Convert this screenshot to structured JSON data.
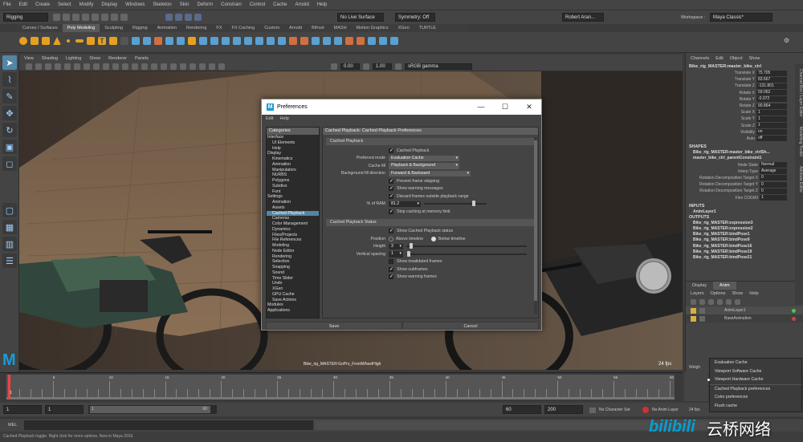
{
  "menubar": [
    "File",
    "Edit",
    "Create",
    "Select",
    "Modify",
    "Display",
    "Windows",
    "Skeleton",
    "Skin",
    "Deform",
    "Constrain",
    "Control",
    "Cache",
    "Arnold",
    "Help"
  ],
  "status": {
    "menuset": "Rigging",
    "live_surface": "No Live Surface",
    "symmetry": "Symmetry: Off",
    "user": "Robert Aran...",
    "workspace_label": "Workspace :",
    "workspace": "Maya Classic*"
  },
  "shelf_tabs": [
    "Curves / Surfaces",
    "Poly Modeling",
    "Sculpting",
    "Rigging",
    "Animation",
    "Rendering",
    "FX",
    "FX Caching",
    "Custom",
    "Arnold",
    "Bifrost",
    "MASH",
    "Motion Graphics",
    "XGen",
    "TURTLE"
  ],
  "shelf_active_tab": "Poly Modeling",
  "panel_menu": [
    "View",
    "Shading",
    "Lighting",
    "Show",
    "Renderer",
    "Panels"
  ],
  "viewport": {
    "exposure": "0.00",
    "gamma": "1.00",
    "colorspace": "sRGB gamma",
    "camera_label": "Bike_rig_MASTER:GoPro_FrontWheelHigh",
    "fps": "24 fps"
  },
  "channel_box": {
    "menu": [
      "Channels",
      "Edit",
      "Object",
      "Show"
    ],
    "object": "Bike_rig_MASTER:master_bike_ctrl",
    "channels": [
      {
        "name": "Translate X",
        "value": "75.705"
      },
      {
        "name": "Translate Y",
        "value": "83.667"
      },
      {
        "name": "Translate Z",
        "value": "-131.801"
      },
      {
        "name": "Rotate X",
        "value": "59.062"
      },
      {
        "name": "Rotate Y",
        "value": "-0.072"
      },
      {
        "name": "Rotate Z",
        "value": "90.864"
      },
      {
        "name": "Scale X",
        "value": "1"
      },
      {
        "name": "Scale Y",
        "value": "1"
      },
      {
        "name": "Scale Z",
        "value": "1"
      },
      {
        "name": "Visibility",
        "value": "on"
      },
      {
        "name": "Auto",
        "value": "off"
      }
    ],
    "shapes_header": "SHAPES",
    "shapes": [
      "Bike_rig_MASTER:master_bike_ctrlSh...",
      "master_bike_ctrl_parentConstraint1"
    ],
    "constraint_attrs": [
      {
        "name": "Node State",
        "value": "Normal"
      },
      {
        "name": "Interp Type",
        "value": "Average"
      },
      {
        "name": "Rotation Decomposition Target X",
        "value": "0"
      },
      {
        "name": "Rotation Decomposition Target Y",
        "value": "0"
      },
      {
        "name": "Rotation Decomposition Target Z",
        "value": "0"
      },
      {
        "name": "Flex COGWt",
        "value": "1"
      }
    ],
    "inputs_header": "INPUTS",
    "inputs": [
      "AnimLayer1"
    ],
    "outputs_header": "OUTPUTS",
    "outputs": [
      "Bike_rig_MASTER:expression3",
      "Bike_rig_MASTER:expression2",
      "Bike_rig_MASTER:bindPose1",
      "Bike_rig_MASTER:bindPose9",
      "Bike_rig_MASTER:bindPose16",
      "Bike_rig_MASTER:bindPose19",
      "Bike_rig_MASTER:bindPose21"
    ]
  },
  "side_tabs": [
    "Channel Box / Layer Editor",
    "Modelling Toolkit",
    "Attribute Editor"
  ],
  "layer_editor": {
    "tabs": [
      "Display",
      "Anim"
    ],
    "menu": [
      "Layers",
      "Options",
      "Show",
      "Help"
    ],
    "layers": [
      "AnimLayer1",
      "BaseAnimation"
    ],
    "weight_label": "Weigh"
  },
  "timeline": {
    "ticks": [
      "1",
      "5",
      "10",
      "15",
      "20",
      "25",
      "30",
      "35",
      "40",
      "45",
      "50",
      "55",
      "60"
    ],
    "current": "1"
  },
  "range": {
    "start": "1",
    "play_start": "1",
    "slider_left": "1",
    "slider_right": "60",
    "play_end": "60",
    "end": "200",
    "character_set": "No Character Set",
    "anim_layer": "No Anim Layer",
    "fps": "24 fps"
  },
  "mel_label": "MEL",
  "help_line": "Cached Playback toggle. Right click for more options. New in Maya 2019.",
  "watermark": "云桥网络",
  "context_menu": {
    "items": [
      "Evaluation Cache",
      "Viewport Software Cache",
      "Viewport Hardware Cache",
      "Cached Playback preferences",
      "Color preferences",
      "Flush cache"
    ],
    "selected": "Viewport Hardware Cache"
  },
  "prefs": {
    "title": "Preferences",
    "menu": [
      "Edit",
      "Help"
    ],
    "categories_label": "Categories",
    "categories": [
      {
        "label": "Interface",
        "level": 0
      },
      {
        "label": "UI Elements",
        "level": 1
      },
      {
        "label": "Help",
        "level": 1
      },
      {
        "label": "Display",
        "level": 0
      },
      {
        "label": "Kinematics",
        "level": 1
      },
      {
        "label": "Animation",
        "level": 1
      },
      {
        "label": "Manipulators",
        "level": 1
      },
      {
        "label": "NURBS",
        "level": 1
      },
      {
        "label": "Polygons",
        "level": 1
      },
      {
        "label": "Subdivs",
        "level": 1
      },
      {
        "label": "Font",
        "level": 1
      },
      {
        "label": "Settings",
        "level": 0
      },
      {
        "label": "Animation",
        "level": 1
      },
      {
        "label": "Assets",
        "level": 1
      },
      {
        "label": "Cached Playback",
        "level": 1,
        "selected": true
      },
      {
        "label": "Cameras",
        "level": 1
      },
      {
        "label": "Color Management",
        "level": 1
      },
      {
        "label": "Dynamics",
        "level": 1
      },
      {
        "label": "Files/Projects",
        "level": 1
      },
      {
        "label": "File References",
        "level": 1
      },
      {
        "label": "Modeling",
        "level": 1
      },
      {
        "label": "Node Editor",
        "level": 1
      },
      {
        "label": "Rendering",
        "level": 1
      },
      {
        "label": "Selection",
        "level": 1
      },
      {
        "label": "Snapping",
        "level": 1
      },
      {
        "label": "Sound",
        "level": 1
      },
      {
        "label": "Time Slider",
        "level": 1
      },
      {
        "label": "Undo",
        "level": 1
      },
      {
        "label": "XGen",
        "level": 1
      },
      {
        "label": "GPU Cache",
        "level": 1
      },
      {
        "label": "Save Actions",
        "level": 1
      },
      {
        "label": "Modules",
        "level": 0
      },
      {
        "label": "Applications",
        "level": 0
      }
    ],
    "section_title": "Cached Playback: Cached Playback Preferences",
    "group1": "Cached Playback",
    "cached_playback_cb": "Cached Playback",
    "preferred_mode_label": "Preferred mode",
    "preferred_mode": "Evaluation Cache",
    "cache_fill_label": "Cache fill",
    "cache_fill": "Playback & Background",
    "bg_fill_label": "Background fill direction",
    "bg_fill": "Forward & Backward",
    "prevent_skip": "Prevent frame skipping",
    "show_warnings": "Show warning messages",
    "discard_frames": "Discard frames outside playback range",
    "ram_label": "% of RAM",
    "ram_value": "81.2",
    "ram_fraction": 0.812,
    "stop_caching": "Stop caching at memory limit",
    "group2": "Cached Playback Status",
    "show_status": "Show Cached Playback status",
    "position_label": "Position",
    "above_timeline": "Above timeline",
    "below_timeline": "Below timeline",
    "height_label": "Height",
    "height_value": "3",
    "height_fraction": 0.03,
    "vspacing_label": "Vertical spacing",
    "vspacing_value": "1",
    "vspacing_fraction": 0.01,
    "show_invalidated": "Show invalidated frames",
    "show_subframes": "Show subframes",
    "show_warning_frames": "Show warning frames",
    "save": "Save",
    "cancel": "Cancel"
  },
  "colors": {
    "selection": "#5285a6",
    "maya_logo": "#1a9bd7",
    "bilibili": "#00a1d6"
  }
}
